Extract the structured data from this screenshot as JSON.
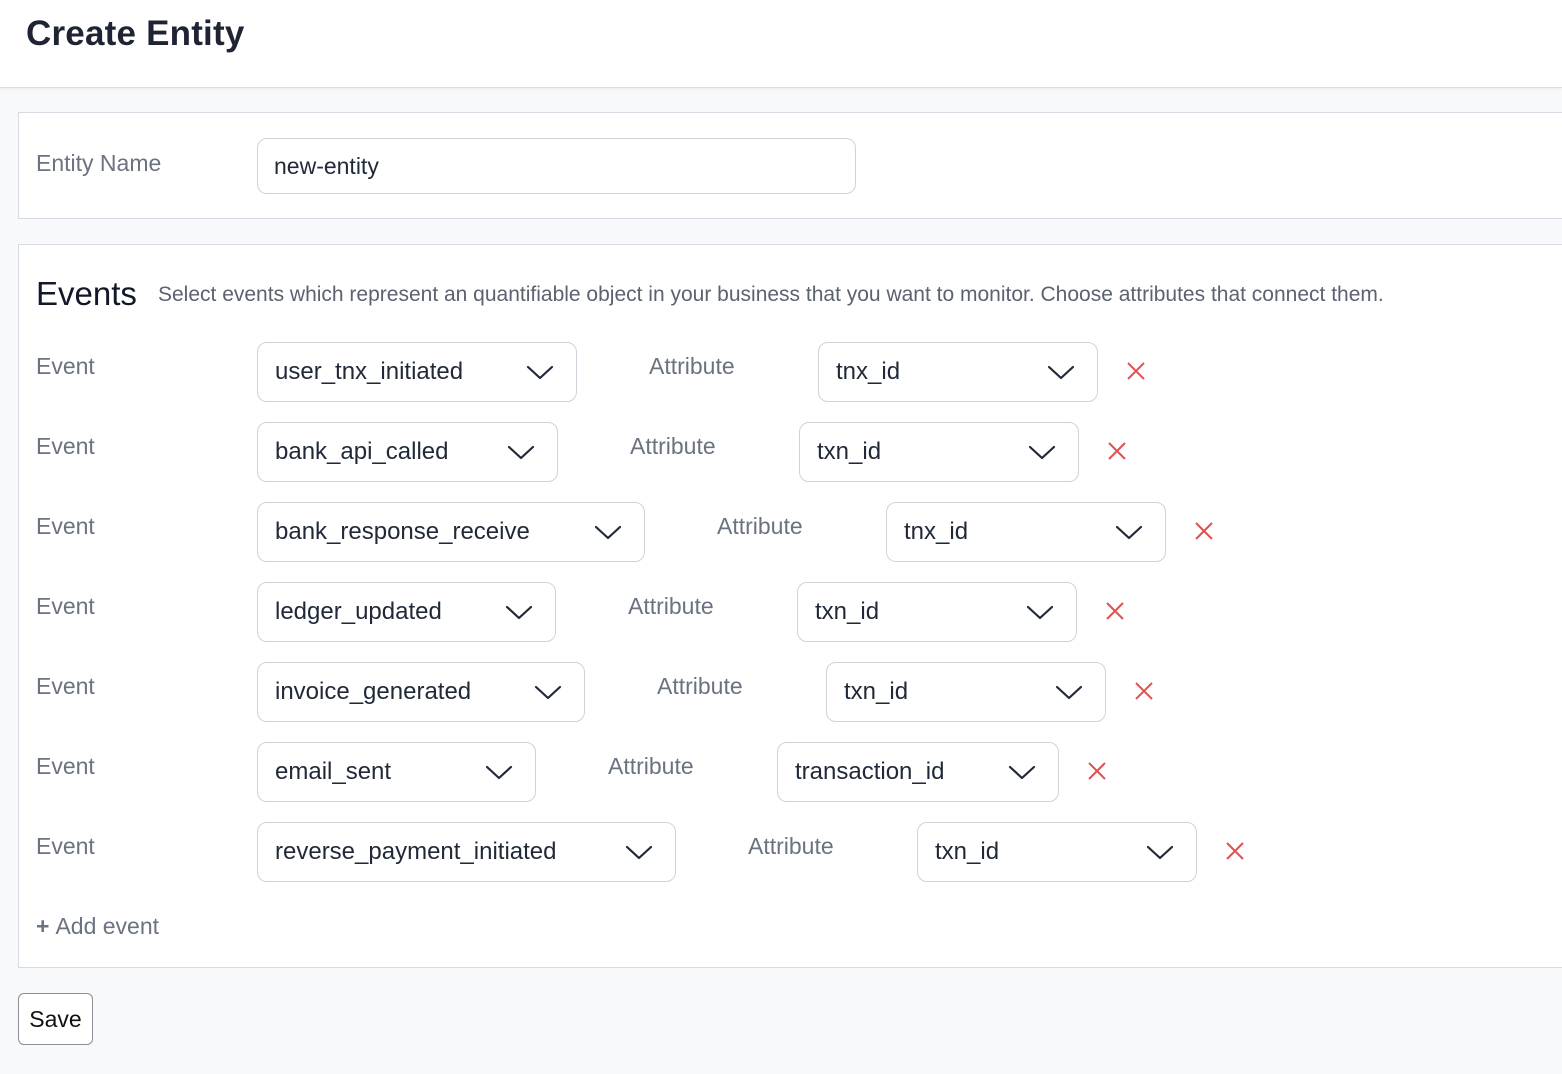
{
  "header": {
    "title": "Create Entity"
  },
  "entity": {
    "name_label": "Entity Name",
    "name_value": "new-entity"
  },
  "events_section": {
    "title": "Events",
    "description": "Select events which represent an quantifiable object in your business that you want to monitor. Choose attributes that connect them.",
    "event_label": "Event",
    "attribute_label": "Attribute",
    "rows": [
      {
        "event": "user_tnx_initiated",
        "attribute": "tnx_id"
      },
      {
        "event": "bank_api_called",
        "attribute": "txn_id"
      },
      {
        "event": "bank_response_receive",
        "attribute": "tnx_id"
      },
      {
        "event": "ledger_updated",
        "attribute": "txn_id"
      },
      {
        "event": "invoice_generated",
        "attribute": "txn_id"
      },
      {
        "event": "email_sent",
        "attribute": "transaction_id"
      },
      {
        "event": "reverse_payment_initiated",
        "attribute": "txn_id"
      }
    ],
    "add_event_label": "Add event",
    "add_event_icon": "plus-icon",
    "remove_icon": "close-icon",
    "remove_color": "#e05252"
  },
  "footer": {
    "save_label": "Save"
  }
}
